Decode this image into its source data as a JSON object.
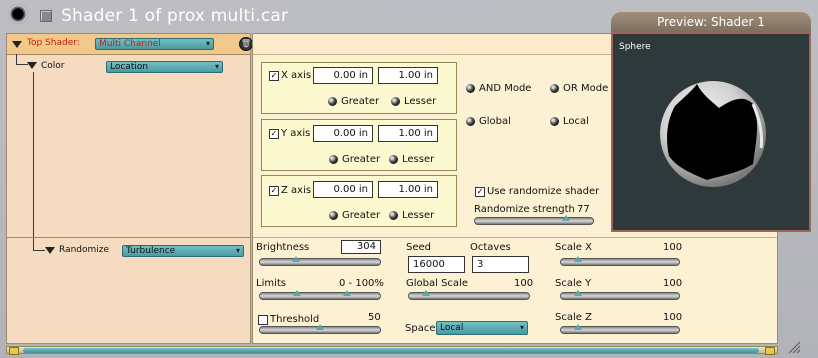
{
  "window": {
    "title": "Shader 1 of prox multi.car"
  },
  "tree": {
    "top_shader_label": "Top Shader:",
    "top_shader_value": "Multi Channel",
    "color_label": "Color",
    "color_value": "Location",
    "randomize_label": "Randomize",
    "randomize_value": "Turbulence"
  },
  "location": {
    "x_axis": {
      "label": "X axis",
      "from": "0.00 in",
      "to": "1.00 in",
      "checked": true
    },
    "y_axis": {
      "label": "Y axis",
      "from": "0.00 in",
      "to": "1.00 in",
      "checked": true
    },
    "z_axis": {
      "label": "Z axis",
      "from": "0.00 in",
      "to": "1.00 in",
      "checked": true
    },
    "greater_label": "Greater",
    "lesser_label": "Lesser",
    "and_mode": "AND Mode",
    "or_mode": "OR Mode",
    "global": "Global",
    "local": "Local",
    "use_randomize": "Use randomize shader",
    "randomize_strength_label": "Randomize strength",
    "randomize_strength_value": "77",
    "randomize_strength_fraction": 0.77
  },
  "turbulence": {
    "brightness_label": "Brightness",
    "brightness_value": "304",
    "seed_label": "Seed",
    "seed_value": "16000",
    "octaves_label": "Octaves",
    "octaves_value": "3",
    "scale_x_label": "Scale X",
    "scale_x_value": "100",
    "limits_label": "Limits",
    "limits_value": "0 - 100%",
    "global_scale_label": "Global Scale",
    "global_scale_value": "100",
    "scale_y_label": "Scale Y",
    "scale_y_value": "100",
    "threshold_label": "Threshold",
    "threshold_value": "50",
    "space_label": "Space",
    "space_value": "Local",
    "scale_z_label": "Scale Z",
    "scale_z_value": "100"
  },
  "preview": {
    "title": "Preview: Shader 1",
    "label": "Sphere"
  },
  "colors": {
    "accent_teal": "#4a9aa1",
    "tree_bg": "#f5dcc0",
    "panel_bg": "#fdf1d4",
    "label_red": "#c81e0a"
  }
}
